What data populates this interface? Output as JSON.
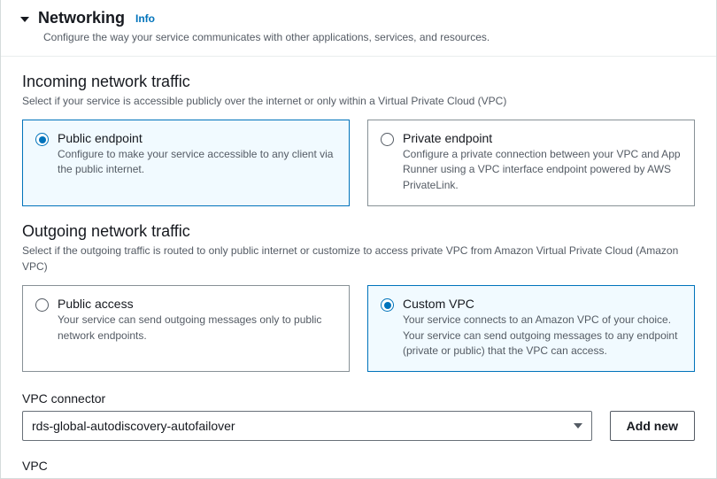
{
  "panel": {
    "title": "Networking",
    "info": "Info",
    "subtitle": "Configure the way your service communicates with other applications, services, and resources."
  },
  "incoming": {
    "title": "Incoming network traffic",
    "desc": "Select if your service is accessible publicly over the internet or only within a Virtual Private Cloud (VPC)",
    "options": {
      "public": {
        "label": "Public endpoint",
        "desc": "Configure to make your service accessible to any client via the public internet."
      },
      "private": {
        "label": "Private endpoint",
        "desc": "Configure a private connection between your VPC and App Runner using a VPC interface endpoint powered by AWS PrivateLink."
      }
    }
  },
  "outgoing": {
    "title": "Outgoing network traffic",
    "desc": "Select if the outgoing traffic is routed to only public internet or customize to access private VPC from Amazon Virtual Private Cloud (Amazon VPC)",
    "options": {
      "public": {
        "label": "Public access",
        "desc": "Your service can send outgoing messages only to public network endpoints."
      },
      "custom": {
        "label": "Custom VPC",
        "desc": "Your service connects to an Amazon VPC of your choice. Your service can send outgoing messages to any endpoint (private or public) that the VPC can access."
      }
    }
  },
  "connector": {
    "label": "VPC connector",
    "value": "rds-global-autodiscovery-autofailover",
    "add_new": "Add new"
  },
  "vpc": {
    "label": "VPC"
  }
}
